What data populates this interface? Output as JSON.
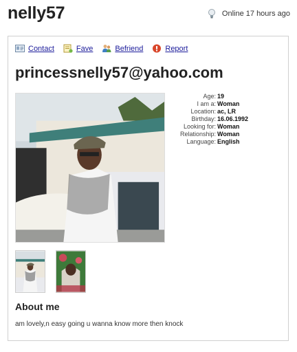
{
  "profile": {
    "username": "nelly57",
    "status": "Online 17 hours ago",
    "email": "princessnelly57@yahoo.com"
  },
  "actions": [
    {
      "label": "Contact",
      "icon": "contact-card-icon"
    },
    {
      "label": "Fave",
      "icon": "fave-note-icon"
    },
    {
      "label": "Befriend",
      "icon": "befriend-people-icon"
    },
    {
      "label": "Report",
      "icon": "report-warning-icon"
    }
  ],
  "details": [
    {
      "label": "Age:",
      "value": "19"
    },
    {
      "label": "I am a:",
      "value": "Woman"
    },
    {
      "label": "Location:",
      "value": "ac, LR"
    },
    {
      "label": "Birthday:",
      "value": "16.06.1992"
    },
    {
      "label": "Looking for:",
      "value": "Woman"
    },
    {
      "label": "Relationship:",
      "value": "Woman"
    },
    {
      "label": "Language:",
      "value": "English"
    }
  ],
  "about": {
    "title": "About me",
    "text": "am lovely,n easy going u wanna know more then knock"
  },
  "colors": {
    "link": "#1a1a9a",
    "report_icon": "#d9472b",
    "border": "#cfcfcf"
  }
}
